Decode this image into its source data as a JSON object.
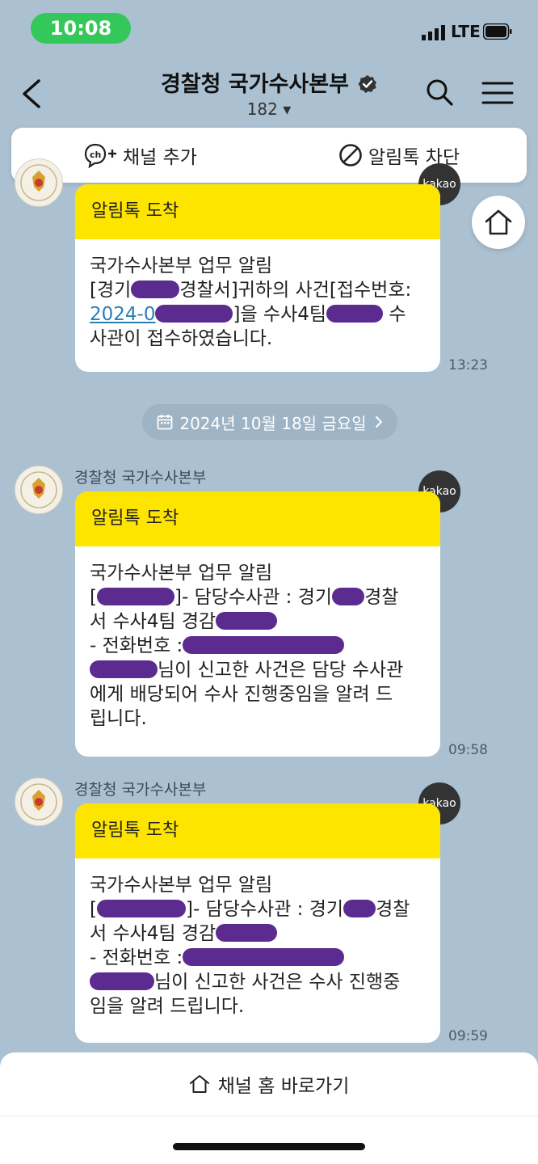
{
  "status_bar": {
    "time": "10:08",
    "network": "LTE"
  },
  "header": {
    "title": "경찰청 국가수사본부",
    "member_count": "182 ▾"
  },
  "actions": {
    "add_channel": "채널 추가",
    "block_alert": "알림톡 차단"
  },
  "messages": [
    {
      "sender": "",
      "badge": "kakao",
      "head": "알림톡 도착",
      "line1": "국가수사본부 업무 알림",
      "line2a": "[경기",
      "line2b": "경찰서]귀하의 사건[접수번호:",
      "line3a": "2024-0",
      "line3b": "]을 수사4팀",
      "line3c": " 수",
      "line4": "사관이 접수하였습니다.",
      "time": "13:23"
    },
    {
      "sender": "경찰청 국가수사본부",
      "badge": "kakao",
      "head": "알림톡 도착",
      "line1": "국가수사본부 업무 알림",
      "line2a": "[",
      "line2b": "]- 담당수사관 : 경기",
      "line2c": "경찰",
      "line3": "서 수사4팀 경감",
      "line4": "- 전화번호 :",
      "line5": "님이 신고한 사건은 담당 수사관",
      "line6": "에게 배당되어 수사 진행중임을 알려 드",
      "line7": "립니다.",
      "time": "09:58"
    },
    {
      "sender": "경찰청 국가수사본부",
      "badge": "kakao",
      "head": "알림톡 도착",
      "line1": "국가수사본부 업무 알림",
      "line2a": "[",
      "line2b": "]- 담당수사관 : 경기",
      "line2c": "경찰",
      "line3": "서 수사4팀 경감",
      "line4": "- 전화번호 :",
      "line5": "님이 신고한 사건은 수사 진행중",
      "line6": "임을 알려 드립니다.",
      "time": "09:59"
    }
  ],
  "date_divider": "2024년 10월 18일 금요일",
  "bottom": {
    "channel_home": "채널 홈 바로가기"
  }
}
